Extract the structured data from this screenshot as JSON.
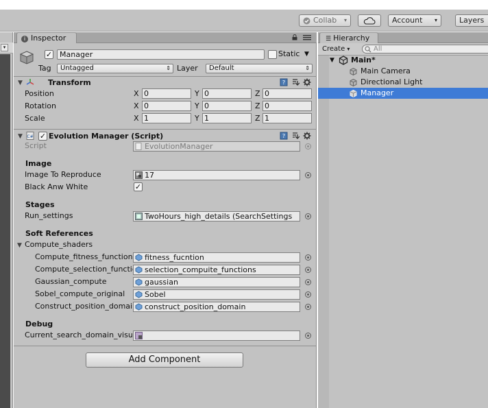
{
  "toolbar": {
    "collab": "Collab",
    "account": "Account",
    "layers": "Layers",
    "icons": [
      "check-circle-icon",
      "cloud-icon"
    ]
  },
  "inspector": {
    "tab_label": "Inspector",
    "object": {
      "name": "Manager",
      "active": true,
      "static_label": "Static",
      "static": false,
      "tag_label": "Tag",
      "tag": "Untagged",
      "layer_label": "Layer",
      "layer": "Default"
    },
    "transform": {
      "title": "Transform",
      "rows": [
        {
          "label": "Position",
          "x": "0",
          "y": "0",
          "z": "0"
        },
        {
          "label": "Rotation",
          "x": "0",
          "y": "0",
          "z": "0"
        },
        {
          "label": "Scale",
          "x": "1",
          "y": "1",
          "z": "1"
        }
      ],
      "axis": [
        "X",
        "Y",
        "Z"
      ]
    },
    "script_component": {
      "title": "Evolution Manager (Script)",
      "enabled": true,
      "script_label": "Script",
      "script_value": "EvolutionManager",
      "sections": {
        "image": "Image",
        "stages": "Stages",
        "soft_references": "Soft References",
        "debug": "Debug"
      },
      "image_to_reproduce_label": "Image To Reproduce",
      "image_to_reproduce_value": "17",
      "black_and_white_label": "Black Anw White",
      "black_and_white": true,
      "run_settings_label": "Run_settings",
      "run_settings_value": "TwoHours_high_details (SearchSettings",
      "compute_shaders_label": "Compute_shaders",
      "shaders": [
        {
          "label": "Compute_fitness_function",
          "value": "fitness_fucntion"
        },
        {
          "label": "Compute_selection_functions",
          "value": "selection_compuite_functions"
        },
        {
          "label": "Gaussian_compute",
          "value": "gaussian"
        },
        {
          "label": "Sobel_compute_original",
          "value": "Sobel"
        },
        {
          "label": "Construct_position_domain",
          "value": "construct_position_domain"
        }
      ],
      "current_search_label": "Current_search_domain_visualization",
      "current_search_value": ""
    },
    "add_component": "Add Component"
  },
  "hierarchy": {
    "tab_label": "Hierarchy",
    "create_label": "Create",
    "search_placeholder": "All",
    "scene": "Main*",
    "items": [
      "Main Camera",
      "Directional Light",
      "Manager"
    ],
    "selected": "Manager"
  },
  "colors": {
    "panel_bg": "#c2c2c2",
    "selection": "#3e7bd6",
    "field_bg": "#e9e9e9"
  }
}
